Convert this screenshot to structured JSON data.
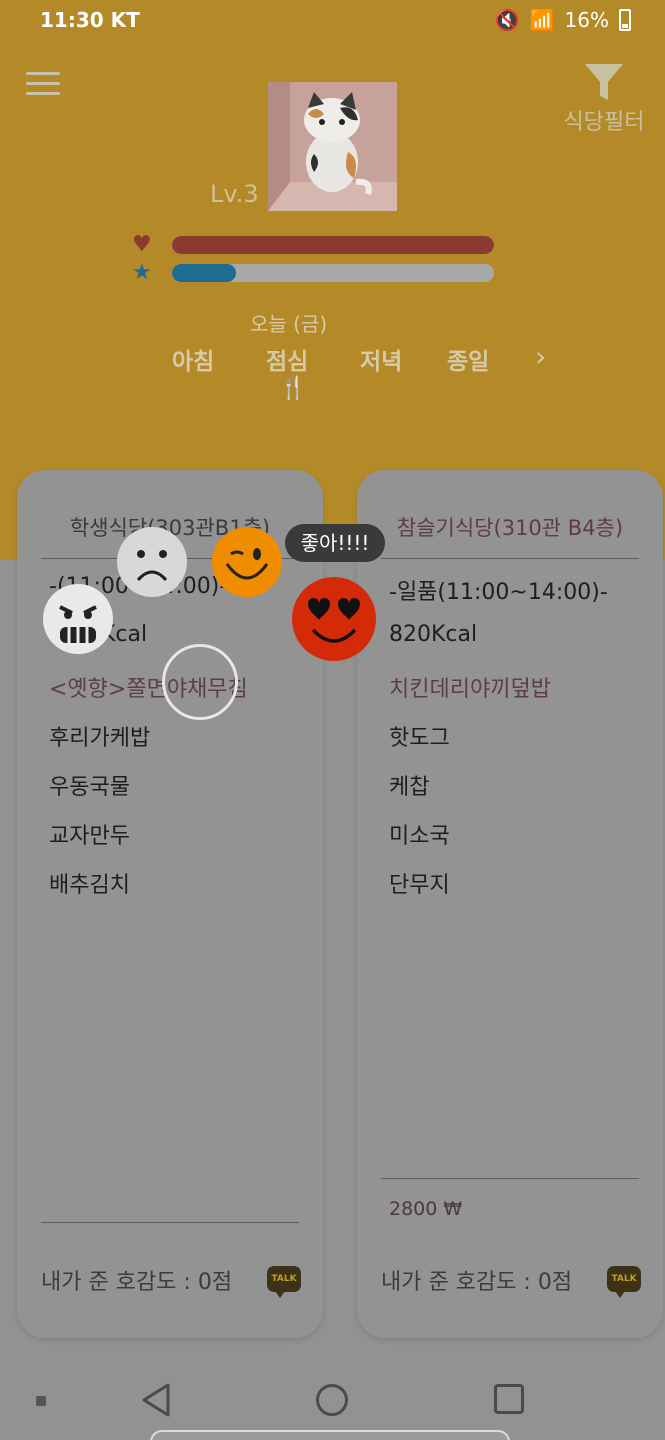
{
  "status": {
    "time": "11:30",
    "carrier": "KT",
    "battery": "16%"
  },
  "header": {
    "filter_label": "식당필터",
    "level": "Lv.3",
    "heart_level": 1.0,
    "star_level": 0.2,
    "today": "오늘 (금)",
    "tabs": [
      "아침",
      "점심",
      "저녁",
      "종일"
    ],
    "next_symbol": "›"
  },
  "cards": [
    {
      "name": "학생식당(303관B1층)",
      "time": "-(11:00~14:00)-",
      "kcal": "Kcal",
      "main": "<옛향>쫄면야채무침",
      "items": [
        "후리가케밥",
        "우동국물",
        "교자만두",
        "배추김치"
      ],
      "rating": "내가 준 호감도 : 0점",
      "talk": "TALK"
    },
    {
      "name": "참슬기식당(310관 B4층)",
      "time": "-일품(11:00~14:00)-",
      "kcal": "820Kcal",
      "main": "치킨데리야끼덮밥",
      "items": [
        "핫도그",
        "케찹",
        "미소국",
        "단무지"
      ],
      "price": "2800 ₩",
      "rating": "내가 준 호감도 : 0점",
      "talk": "TALK"
    }
  ],
  "reaction": {
    "bubble": "좋아!!!!"
  },
  "colors": {
    "heart": "#8a3a2e",
    "star": "#1f6c92",
    "header_bg": "#b48a28"
  }
}
